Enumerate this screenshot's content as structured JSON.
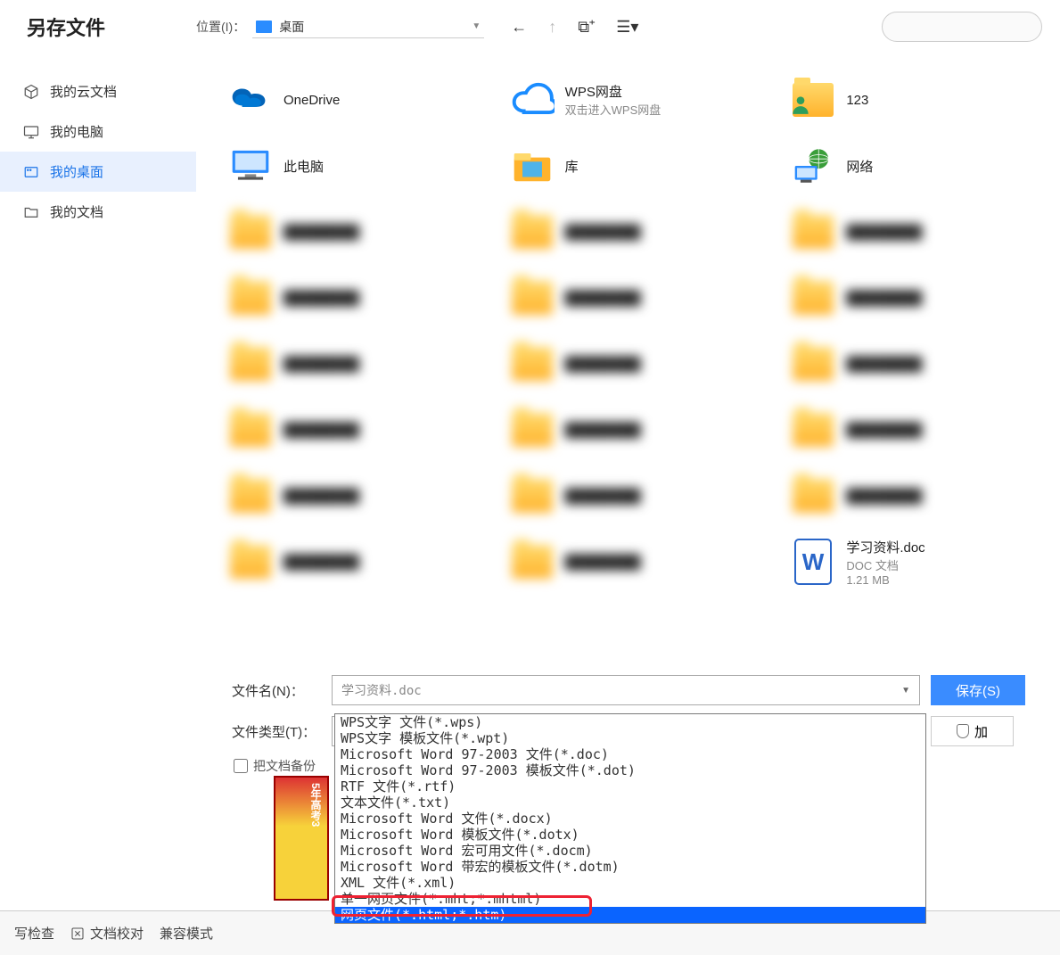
{
  "title": "另存文件",
  "location": {
    "label": "位置(I)：",
    "value": "桌面"
  },
  "search_placeholder": "",
  "sidebar": {
    "items": [
      {
        "label": "我的云文档"
      },
      {
        "label": "我的电脑"
      },
      {
        "label": "我的桌面"
      },
      {
        "label": "我的文档"
      }
    ],
    "selected_index": 2
  },
  "grid": {
    "row0": [
      {
        "name": "OneDrive",
        "sub": "",
        "kind": "onedrive"
      },
      {
        "name": "WPS网盘",
        "sub": "双击进入WPS网盘",
        "kind": "wpscloud"
      },
      {
        "name": "123",
        "sub": "",
        "kind": "userfolder"
      }
    ],
    "row1": [
      {
        "name": "此电脑",
        "sub": "",
        "kind": "pc"
      },
      {
        "name": "库",
        "sub": "",
        "kind": "lib"
      },
      {
        "name": "网络",
        "sub": "",
        "kind": "net"
      }
    ],
    "last": {
      "name": "学习资料.doc",
      "type_line": "DOC 文档",
      "size_line": "1.21 MB"
    }
  },
  "footer": {
    "filename_label": "文件名(N)：",
    "filename_value": "学习资料.doc",
    "filetype_label": "文件类型(T)：",
    "filetype_value": "Microsoft Word 97-2003 文件(*.doc)",
    "save_btn": "保存(S)",
    "encrypt_btn": "加",
    "backup_chk": "把文档备份"
  },
  "filetype_options": [
    "WPS文字 文件(*.wps)",
    "WPS文字 模板文件(*.wpt)",
    "Microsoft Word 97-2003 文件(*.doc)",
    "Microsoft Word 97-2003 模板文件(*.dot)",
    "RTF 文件(*.rtf)",
    "文本文件(*.txt)",
    "Microsoft Word 文件(*.docx)",
    "Microsoft Word 模板文件(*.dotx)",
    "Microsoft Word 宏可用文件(*.docm)",
    "Microsoft Word 带宏的模板文件(*.dotm)",
    "XML 文件(*.xml)",
    "单一网页文件(*.mht;*.mhtml)",
    "网页文件(*.html;*.htm)"
  ],
  "statusbar": {
    "spellcheck": "写检查",
    "doccheck": "文档校对",
    "compat": "兼容模式"
  },
  "book_spine": "5年高考3"
}
